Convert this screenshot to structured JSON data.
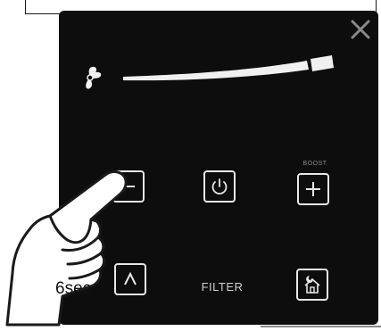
{
  "panel": {
    "icons": {
      "close": "close-icon",
      "fan": "fan-icon",
      "minus": "minus-icon",
      "power": "power-icon",
      "plus": "plus-icon",
      "up": "chevron-up-icon",
      "night": "night-mode-icon"
    },
    "boost_label": "BOOST",
    "filter_label": "FILTER"
  },
  "hand": {
    "duration_label": "6sec"
  },
  "colors": {
    "panel_bg": "#0d0d0d",
    "icon_stroke": "#e8e8e8",
    "page_bg": "#ffffff"
  }
}
